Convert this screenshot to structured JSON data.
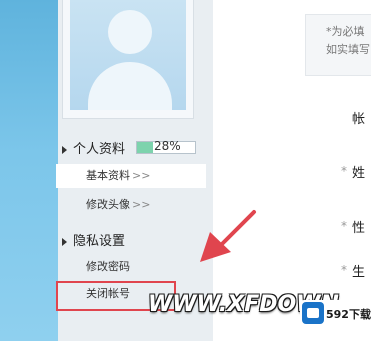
{
  "sidebar": {
    "profile_section": {
      "label": "个人资料",
      "progress_text": "28%",
      "progress_value": 0.28
    },
    "items": [
      {
        "label": "基本资料",
        "chevron": ">>"
      },
      {
        "label": "修改头像",
        "chevron": ">>"
      }
    ],
    "privacy_section": {
      "label": "隐私设置"
    },
    "privacy_items": [
      {
        "label": "修改密码"
      },
      {
        "label": "关闭帐号"
      }
    ]
  },
  "notice": {
    "line1": "*为必填",
    "line2": "如实填写"
  },
  "form": {
    "account_label": "帐",
    "name_label": "姓",
    "gender_label": "性",
    "birth_label": "生",
    "required_mark": "*"
  },
  "watermark": {
    "text": "WWW.XFDOWN"
  },
  "logo": {
    "brand": "592下载网"
  },
  "colors": {
    "highlight": "#e0454e",
    "arrow": "#e0454e",
    "progress_fill": "#7dd3ad",
    "sidebar_bg": "#e9eef2"
  }
}
